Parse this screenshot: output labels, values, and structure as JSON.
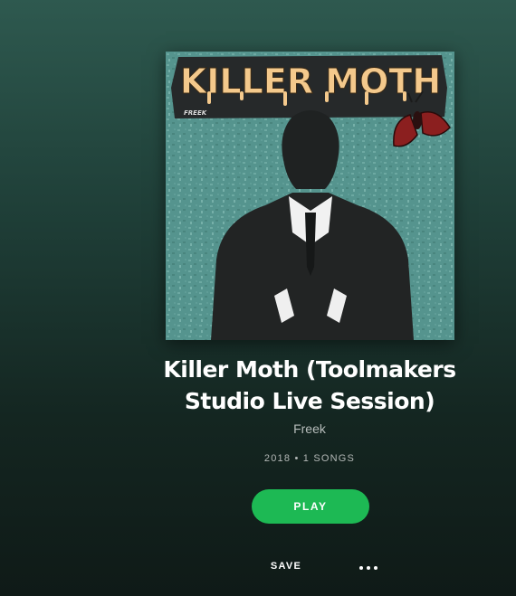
{
  "album": {
    "cover": {
      "band_logo_text": "KILLER MOTH",
      "label_text": "FREEK"
    },
    "title": "Killer Moth (Toolmakers Studio Live Session)",
    "artist": "Freek",
    "meta": "2018 • 1 SONGS"
  },
  "actions": {
    "play_label": "PLAY",
    "save_label": "SAVE",
    "more_icon": "more-dots-icon"
  },
  "colors": {
    "accent": "#1db954",
    "background_top": "#2e594f",
    "background_bottom": "#0f1a17"
  }
}
